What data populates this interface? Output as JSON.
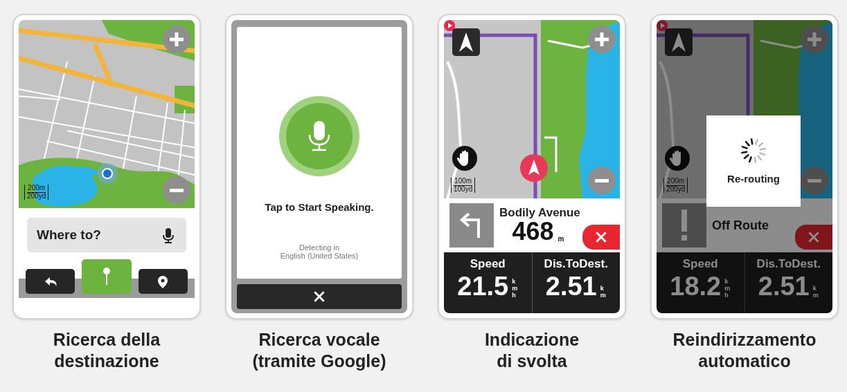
{
  "screens": [
    {
      "kind": "search",
      "map": {
        "scale": {
          "metric": "200m",
          "imperial": "200yd"
        }
      },
      "search": {
        "placeholder": "Where to?"
      },
      "tabs": [
        {
          "selected": false
        },
        {
          "selected": true
        },
        {
          "selected": false
        }
      ],
      "caption": [
        "Ricerca della",
        "destinazione"
      ]
    },
    {
      "kind": "voice",
      "prompt": "Tap to Start Speaking.",
      "detecting": [
        "Detecting in",
        "English (United States)"
      ],
      "caption": [
        "Ricerca vocale",
        "(tramite Google)"
      ]
    },
    {
      "kind": "navigation",
      "dimmed": false,
      "map": {
        "scale": {
          "metric": "100m",
          "imperial": "100yd"
        }
      },
      "instruction": {
        "kind": "turn-left",
        "street": "Bodily Avenue",
        "distance": "468",
        "unit": "m"
      },
      "fields": [
        {
          "label": "Speed",
          "value": "21.5",
          "unit": "kmh"
        },
        {
          "label": "Dis.ToDest.",
          "value": "2.51",
          "unit": "km"
        }
      ],
      "caption": [
        "Indicazione",
        "di svolta"
      ]
    },
    {
      "kind": "navigation",
      "dimmed": true,
      "dialog": {
        "text": "Re-routing"
      },
      "map": {
        "scale": {
          "metric": "200m",
          "imperial": "200yd"
        }
      },
      "instruction": {
        "kind": "off-route",
        "text": "Off Route"
      },
      "fields": [
        {
          "label": "Speed",
          "value": "18.2",
          "unit": "kmh"
        },
        {
          "label": "Dis.ToDest.",
          "value": "2.51",
          "unit": "km"
        }
      ],
      "caption": [
        "Reindirizzamento",
        "automatico"
      ]
    }
  ]
}
